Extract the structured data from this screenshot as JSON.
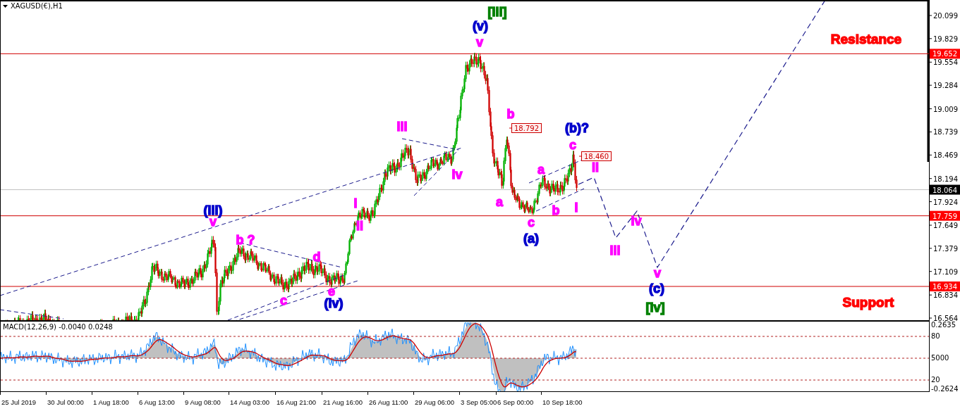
{
  "chart_title": "XAGUSD(€),H1",
  "price_axis": {
    "ticks": [
      "20.099",
      "19.829",
      "19.554",
      "19.284",
      "19.009",
      "18.739",
      "18.469",
      "18.194",
      "17.924",
      "17.649",
      "17.379",
      "17.109",
      "16.834",
      "16.564"
    ]
  },
  "levels": [
    {
      "price": "19.652",
      "kind": "line"
    },
    {
      "price": "18.064",
      "kind": "bid"
    },
    {
      "price": "17.759",
      "kind": "line"
    },
    {
      "price": "16.934",
      "kind": "line"
    }
  ],
  "annotations": [
    {
      "text": "[iii]",
      "kind": "wave",
      "color": "#008000"
    },
    {
      "text": "(v)",
      "kind": "wave",
      "color": "#0000cc"
    },
    {
      "text": "v",
      "kind": "wave",
      "color": "#ff00ff"
    },
    {
      "text": "Resistance",
      "kind": "zone",
      "color": "#ff0000"
    },
    {
      "text": "b",
      "kind": "wave",
      "color": "#ff00ff"
    },
    {
      "text": "iii",
      "kind": "wave",
      "color": "#ff00ff"
    },
    {
      "text": "18.792",
      "kind": "price-box",
      "color": "#cc0000"
    },
    {
      "text": "(b)?",
      "kind": "wave",
      "color": "#0000cc"
    },
    {
      "text": "c",
      "kind": "wave",
      "color": "#ff00ff"
    },
    {
      "text": "18.460",
      "kind": "price-box",
      "color": "#cc0000"
    },
    {
      "text": "iv",
      "kind": "wave",
      "color": "#ff00ff"
    },
    {
      "text": "a",
      "kind": "wave",
      "color": "#ff00ff"
    },
    {
      "text": "ii",
      "kind": "wave",
      "color": "#ff00ff"
    },
    {
      "text": "(iii)",
      "kind": "wave",
      "color": "#0000cc"
    },
    {
      "text": "i",
      "kind": "wave",
      "color": "#ff00ff"
    },
    {
      "text": "a",
      "kind": "wave",
      "color": "#ff00ff"
    },
    {
      "text": "b",
      "kind": "wave",
      "color": "#ff00ff"
    },
    {
      "text": "i",
      "kind": "wave",
      "color": "#ff00ff"
    },
    {
      "text": "v",
      "kind": "wave",
      "color": "#ff00ff"
    },
    {
      "text": "ii",
      "kind": "wave",
      "color": "#ff00ff"
    },
    {
      "text": "c",
      "kind": "wave",
      "color": "#ff00ff"
    },
    {
      "text": "iv",
      "kind": "wave",
      "color": "#ff00ff"
    },
    {
      "text": "b ?",
      "kind": "wave",
      "color": "#ff00ff"
    },
    {
      "text": "(a)",
      "kind": "wave",
      "color": "#0000cc"
    },
    {
      "text": "d",
      "kind": "wave",
      "color": "#ff00ff"
    },
    {
      "text": "iii",
      "kind": "wave",
      "color": "#ff00ff"
    },
    {
      "text": "v",
      "kind": "wave",
      "color": "#ff00ff"
    },
    {
      "text": "e",
      "kind": "wave",
      "color": "#ff00ff"
    },
    {
      "text": "(c)",
      "kind": "wave",
      "color": "#0000cc"
    },
    {
      "text": "c",
      "kind": "wave",
      "color": "#ff00ff"
    },
    {
      "text": "(iv)",
      "kind": "wave",
      "color": "#0000cc"
    },
    {
      "text": "[iv]",
      "kind": "wave",
      "color": "#008000"
    },
    {
      "text": "Support",
      "kind": "zone",
      "color": "#ff0000"
    }
  ],
  "macd": {
    "label": "MACD(12,26,9) -0.0040 0.0248",
    "axis_labels": [
      "0.2635",
      "80",
      "5000",
      "20",
      "-0.2624"
    ]
  },
  "time_axis": [
    "25 Jul 2019",
    "30 Jul 00:00",
    "1 Aug 18:00",
    "6 Aug 13:00",
    "9 Aug 08:00",
    "14 Aug 03:00",
    "16 Aug 21:00",
    "21 Aug 16:00",
    "26 Aug 11:00",
    "29 Aug 06:00",
    "3 Sep 05:00",
    "6 Sep 00:00",
    "10 Sep 18:00"
  ]
}
